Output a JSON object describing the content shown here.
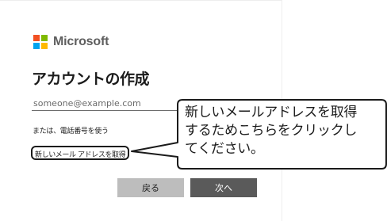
{
  "brand": {
    "logo_text": "Microsoft",
    "logo_colors": [
      "#f25022",
      "#7fba00",
      "#00a4ef",
      "#ffb900"
    ],
    "logo_icon": "microsoft-four-squares-icon"
  },
  "page": {
    "title": "アカウントの作成"
  },
  "form": {
    "email_placeholder": "someone@example.com",
    "phone_link": "または、電話番号を使う",
    "new_email_link": "新しいメール アドレスを取得"
  },
  "buttons": {
    "back": "戻る",
    "next": "次へ"
  },
  "callout": {
    "lines": [
      "新しいメールアドレスを取得",
      "するためこちらをクリックし",
      "てください。"
    ]
  },
  "colors": {
    "back_button_bg": "#bdbdbd",
    "next_button_bg": "#5a5a5a",
    "callout_border": "#1b1b1b"
  }
}
